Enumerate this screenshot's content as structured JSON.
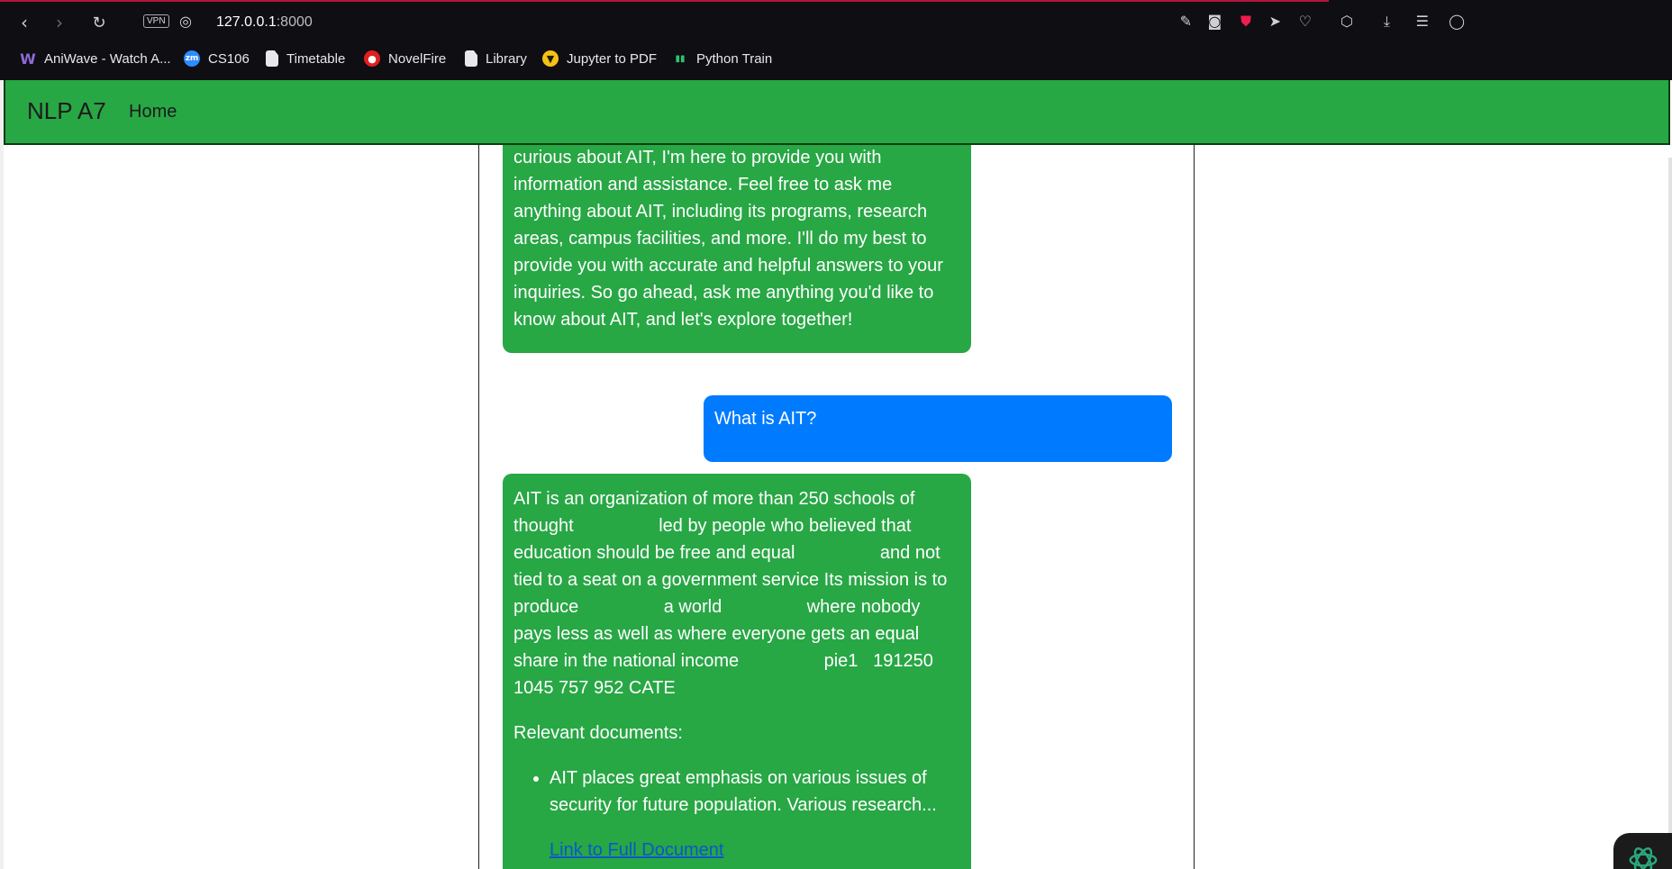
{
  "browser": {
    "vpn_badge": "VPN",
    "url_host": "127.0.0.1",
    "url_port": ":8000",
    "bookmarks": [
      {
        "label": "AniWave - Watch A...",
        "icon": "wave-icon"
      },
      {
        "label": "CS106",
        "icon": "zoom-icon"
      },
      {
        "label": "Timetable",
        "icon": "document-icon"
      },
      {
        "label": "NovelFire",
        "icon": "novelfire-icon"
      },
      {
        "label": "Library",
        "icon": "document-icon"
      },
      {
        "label": "Jupyter to PDF",
        "icon": "jupyter-icon"
      },
      {
        "label": "Python Train",
        "icon": "python-train-icon"
      }
    ],
    "zm_glyph": "zm"
  },
  "navbar": {
    "brand": "NLP A7",
    "home_link": "Home"
  },
  "chat": {
    "messages": [
      {
        "role": "bot",
        "text": "curious about AIT, I'm here to provide you with information and assistance. Feel free to ask me anything about AIT, including its programs, research areas, campus facilities, and more. I'll do my best to provide you with accurate and helpful answers to your inquiries. So go ahead, ask me anything you'd like to know about AIT, and let's explore together!"
      },
      {
        "role": "user",
        "text": "What is AIT?"
      },
      {
        "role": "bot",
        "text": "AIT is an organization of more than 250 schools of thought                 led by people who believed that education should be free and equal                 and not tied to a seat on a government service Its mission is to produce                 a world                 where nobody pays less as well as where everyone gets an equal share in the national income                 pie1   191250 1045 757 952 CATE",
        "relevant_label": "Relevant documents:",
        "documents": [
          {
            "snippet": "AIT places great emphasis on various issues of security for future population. Various research...",
            "link_text": "Link to Full Document"
          }
        ]
      }
    ]
  },
  "colors": {
    "navbar_green": "#28a745",
    "bot_bubble": "#28a745",
    "user_bubble": "#007bff",
    "browser_bg": "#0f0e12",
    "shield_red": "#ef1d4d"
  }
}
